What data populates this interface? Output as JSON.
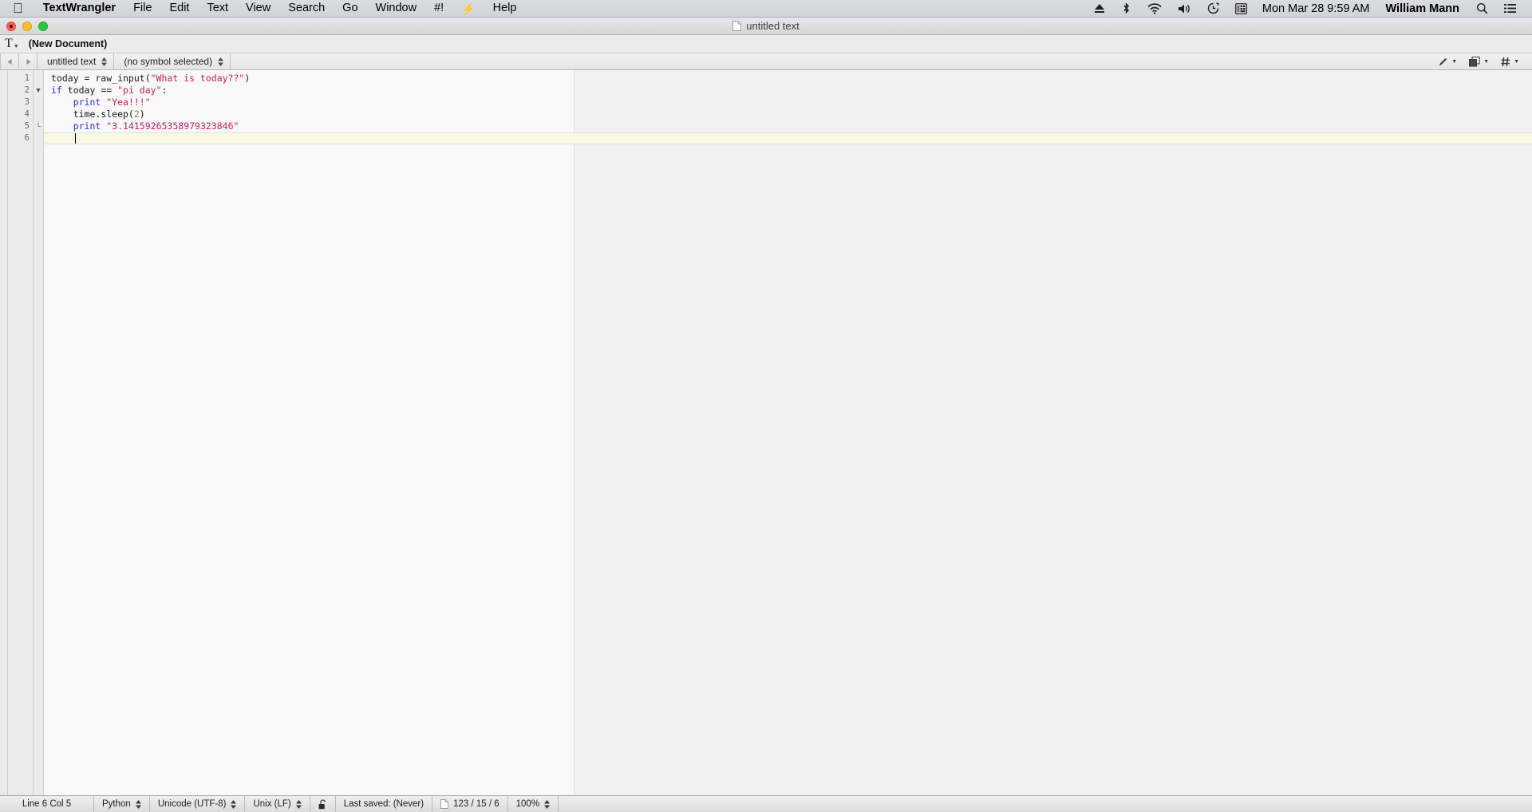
{
  "menubar": {
    "apple_icon": "apple-logo",
    "items": [
      {
        "label": "TextWrangler",
        "bold": true
      },
      {
        "label": "File"
      },
      {
        "label": "Edit"
      },
      {
        "label": "Text"
      },
      {
        "label": "View"
      },
      {
        "label": "Search"
      },
      {
        "label": "Go"
      },
      {
        "label": "Window"
      },
      {
        "label": "#!"
      },
      {
        "label": "⚡"
      },
      {
        "label": "Help"
      }
    ],
    "status_icons": [
      "eject-icon",
      "bluetooth-icon",
      "wifi-icon",
      "volume-icon",
      "time-machine-icon",
      "input-source-icon"
    ],
    "clock": "Mon Mar 28  9:59 AM",
    "user": "William Mann",
    "search_icon": "search-icon",
    "notification_center_icon": "notification-center-icon"
  },
  "window": {
    "title": "untitled text",
    "title_icon": "document-icon",
    "traffic_lights": [
      "close-button",
      "minimize-button",
      "zoom-button"
    ]
  },
  "docbar": {
    "text_icon": "text-document-icon",
    "document_name": "(New Document)"
  },
  "navbar": {
    "back_icon": "back-arrow-icon",
    "forward_icon": "forward-arrow-icon",
    "file_popup_value": "untitled text",
    "symbol_popup_value": "(no symbol selected)",
    "tools": [
      {
        "icon": "pencil-icon",
        "name": "text-options-menu"
      },
      {
        "icon": "split-pane-icon",
        "name": "split-view-menu"
      },
      {
        "icon": "hash-icon",
        "name": "language-menu"
      }
    ]
  },
  "editor": {
    "line_numbers": [
      "1",
      "2",
      "3",
      "4",
      "5",
      "6"
    ],
    "fold_markers": [
      "",
      "▼",
      "",
      "",
      "└",
      ""
    ],
    "cursor_line_index": 5,
    "colors": {
      "keyword": "#2f2fd8",
      "string": "#c7225f",
      "number": "#d2691e",
      "plain": "#1a1a1a",
      "current_line_highlight": "#f8f8e4",
      "page_background": "#f9f9f9",
      "outside_background": "#f1f1f1"
    },
    "lines": [
      {
        "number": "1",
        "tokens": [
          {
            "t": "today = raw_input(",
            "c": "plain"
          },
          {
            "t": "\"What is today??\"",
            "c": "string"
          },
          {
            "t": ")",
            "c": "plain"
          }
        ]
      },
      {
        "number": "2",
        "tokens": [
          {
            "t": "if",
            "c": "keyword"
          },
          {
            "t": " today == ",
            "c": "plain"
          },
          {
            "t": "\"pi day\"",
            "c": "string"
          },
          {
            "t": ":",
            "c": "plain"
          }
        ]
      },
      {
        "number": "3",
        "tokens": [
          {
            "t": "    ",
            "c": "plain"
          },
          {
            "t": "print",
            "c": "keyword"
          },
          {
            "t": " ",
            "c": "plain"
          },
          {
            "t": "\"Yea!!!\"",
            "c": "string"
          }
        ]
      },
      {
        "number": "4",
        "tokens": [
          {
            "t": "    time.sleep(",
            "c": "plain"
          },
          {
            "t": "2",
            "c": "number"
          },
          {
            "t": ")",
            "c": "plain"
          }
        ]
      },
      {
        "number": "5",
        "tokens": [
          {
            "t": "    ",
            "c": "plain"
          },
          {
            "t": "print",
            "c": "keyword"
          },
          {
            "t": " ",
            "c": "plain"
          },
          {
            "t": "\"3.14159265358979323846\"",
            "c": "string"
          }
        ]
      },
      {
        "number": "6",
        "tokens": [
          {
            "t": "    ",
            "c": "plain"
          }
        ]
      }
    ]
  },
  "statusbar": {
    "cursor_position": "Line 6 Col 5",
    "language": "Python",
    "encoding": "Unicode (UTF-8)",
    "line_endings": "Unix (LF)",
    "lock_icon": "unlocked-padlock-icon",
    "last_saved": "Last saved: (Never)",
    "doc_stats_icon": "document-icon",
    "doc_stats": "123 / 15 / 6",
    "zoom": "100%"
  }
}
